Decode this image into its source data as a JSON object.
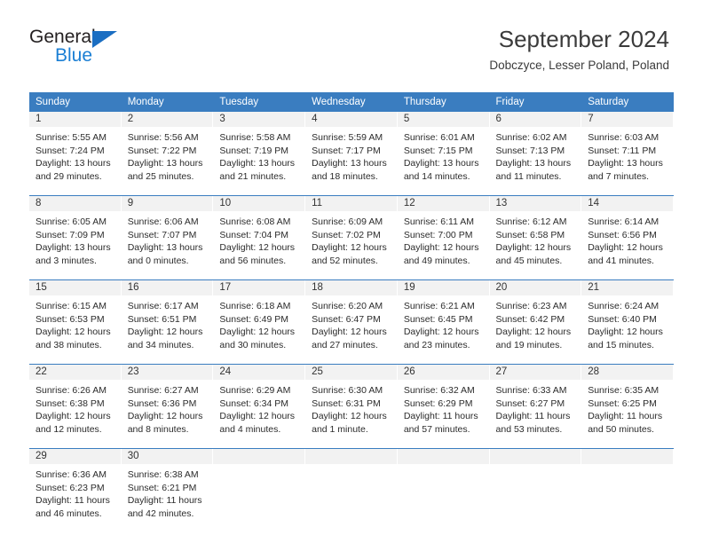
{
  "logo": {
    "word_top": "General",
    "word_bottom": "Blue",
    "triangle_color": "#1b6ec2",
    "blue_color": "#1b7fd4"
  },
  "header": {
    "title": "September 2024",
    "subtitle": "Dobczyce, Lesser Poland, Poland"
  },
  "theme": {
    "header_bg": "#3a7dc0",
    "header_text": "#ffffff",
    "daynum_band_bg": "#f2f2f2",
    "rule_color": "#3a7dc0"
  },
  "calendar": {
    "weekday_headers": [
      "Sunday",
      "Monday",
      "Tuesday",
      "Wednesday",
      "Thursday",
      "Friday",
      "Saturday"
    ],
    "weeks": [
      [
        {
          "day": "1",
          "sunrise": "Sunrise: 5:55 AM",
          "sunset": "Sunset: 7:24 PM",
          "daylight1": "Daylight: 13 hours",
          "daylight2": "and 29 minutes."
        },
        {
          "day": "2",
          "sunrise": "Sunrise: 5:56 AM",
          "sunset": "Sunset: 7:22 PM",
          "daylight1": "Daylight: 13 hours",
          "daylight2": "and 25 minutes."
        },
        {
          "day": "3",
          "sunrise": "Sunrise: 5:58 AM",
          "sunset": "Sunset: 7:19 PM",
          "daylight1": "Daylight: 13 hours",
          "daylight2": "and 21 minutes."
        },
        {
          "day": "4",
          "sunrise": "Sunrise: 5:59 AM",
          "sunset": "Sunset: 7:17 PM",
          "daylight1": "Daylight: 13 hours",
          "daylight2": "and 18 minutes."
        },
        {
          "day": "5",
          "sunrise": "Sunrise: 6:01 AM",
          "sunset": "Sunset: 7:15 PM",
          "daylight1": "Daylight: 13 hours",
          "daylight2": "and 14 minutes."
        },
        {
          "day": "6",
          "sunrise": "Sunrise: 6:02 AM",
          "sunset": "Sunset: 7:13 PM",
          "daylight1": "Daylight: 13 hours",
          "daylight2": "and 11 minutes."
        },
        {
          "day": "7",
          "sunrise": "Sunrise: 6:03 AM",
          "sunset": "Sunset: 7:11 PM",
          "daylight1": "Daylight: 13 hours",
          "daylight2": "and 7 minutes."
        }
      ],
      [
        {
          "day": "8",
          "sunrise": "Sunrise: 6:05 AM",
          "sunset": "Sunset: 7:09 PM",
          "daylight1": "Daylight: 13 hours",
          "daylight2": "and 3 minutes."
        },
        {
          "day": "9",
          "sunrise": "Sunrise: 6:06 AM",
          "sunset": "Sunset: 7:07 PM",
          "daylight1": "Daylight: 13 hours",
          "daylight2": "and 0 minutes."
        },
        {
          "day": "10",
          "sunrise": "Sunrise: 6:08 AM",
          "sunset": "Sunset: 7:04 PM",
          "daylight1": "Daylight: 12 hours",
          "daylight2": "and 56 minutes."
        },
        {
          "day": "11",
          "sunrise": "Sunrise: 6:09 AM",
          "sunset": "Sunset: 7:02 PM",
          "daylight1": "Daylight: 12 hours",
          "daylight2": "and 52 minutes."
        },
        {
          "day": "12",
          "sunrise": "Sunrise: 6:11 AM",
          "sunset": "Sunset: 7:00 PM",
          "daylight1": "Daylight: 12 hours",
          "daylight2": "and 49 minutes."
        },
        {
          "day": "13",
          "sunrise": "Sunrise: 6:12 AM",
          "sunset": "Sunset: 6:58 PM",
          "daylight1": "Daylight: 12 hours",
          "daylight2": "and 45 minutes."
        },
        {
          "day": "14",
          "sunrise": "Sunrise: 6:14 AM",
          "sunset": "Sunset: 6:56 PM",
          "daylight1": "Daylight: 12 hours",
          "daylight2": "and 41 minutes."
        }
      ],
      [
        {
          "day": "15",
          "sunrise": "Sunrise: 6:15 AM",
          "sunset": "Sunset: 6:53 PM",
          "daylight1": "Daylight: 12 hours",
          "daylight2": "and 38 minutes."
        },
        {
          "day": "16",
          "sunrise": "Sunrise: 6:17 AM",
          "sunset": "Sunset: 6:51 PM",
          "daylight1": "Daylight: 12 hours",
          "daylight2": "and 34 minutes."
        },
        {
          "day": "17",
          "sunrise": "Sunrise: 6:18 AM",
          "sunset": "Sunset: 6:49 PM",
          "daylight1": "Daylight: 12 hours",
          "daylight2": "and 30 minutes."
        },
        {
          "day": "18",
          "sunrise": "Sunrise: 6:20 AM",
          "sunset": "Sunset: 6:47 PM",
          "daylight1": "Daylight: 12 hours",
          "daylight2": "and 27 minutes."
        },
        {
          "day": "19",
          "sunrise": "Sunrise: 6:21 AM",
          "sunset": "Sunset: 6:45 PM",
          "daylight1": "Daylight: 12 hours",
          "daylight2": "and 23 minutes."
        },
        {
          "day": "20",
          "sunrise": "Sunrise: 6:23 AM",
          "sunset": "Sunset: 6:42 PM",
          "daylight1": "Daylight: 12 hours",
          "daylight2": "and 19 minutes."
        },
        {
          "day": "21",
          "sunrise": "Sunrise: 6:24 AM",
          "sunset": "Sunset: 6:40 PM",
          "daylight1": "Daylight: 12 hours",
          "daylight2": "and 15 minutes."
        }
      ],
      [
        {
          "day": "22",
          "sunrise": "Sunrise: 6:26 AM",
          "sunset": "Sunset: 6:38 PM",
          "daylight1": "Daylight: 12 hours",
          "daylight2": "and 12 minutes."
        },
        {
          "day": "23",
          "sunrise": "Sunrise: 6:27 AM",
          "sunset": "Sunset: 6:36 PM",
          "daylight1": "Daylight: 12 hours",
          "daylight2": "and 8 minutes."
        },
        {
          "day": "24",
          "sunrise": "Sunrise: 6:29 AM",
          "sunset": "Sunset: 6:34 PM",
          "daylight1": "Daylight: 12 hours",
          "daylight2": "and 4 minutes."
        },
        {
          "day": "25",
          "sunrise": "Sunrise: 6:30 AM",
          "sunset": "Sunset: 6:31 PM",
          "daylight1": "Daylight: 12 hours",
          "daylight2": "and 1 minute."
        },
        {
          "day": "26",
          "sunrise": "Sunrise: 6:32 AM",
          "sunset": "Sunset: 6:29 PM",
          "daylight1": "Daylight: 11 hours",
          "daylight2": "and 57 minutes."
        },
        {
          "day": "27",
          "sunrise": "Sunrise: 6:33 AM",
          "sunset": "Sunset: 6:27 PM",
          "daylight1": "Daylight: 11 hours",
          "daylight2": "and 53 minutes."
        },
        {
          "day": "28",
          "sunrise": "Sunrise: 6:35 AM",
          "sunset": "Sunset: 6:25 PM",
          "daylight1": "Daylight: 11 hours",
          "daylight2": "and 50 minutes."
        }
      ],
      [
        {
          "day": "29",
          "sunrise": "Sunrise: 6:36 AM",
          "sunset": "Sunset: 6:23 PM",
          "daylight1": "Daylight: 11 hours",
          "daylight2": "and 46 minutes."
        },
        {
          "day": "30",
          "sunrise": "Sunrise: 6:38 AM",
          "sunset": "Sunset: 6:21 PM",
          "daylight1": "Daylight: 11 hours",
          "daylight2": "and 42 minutes."
        },
        {
          "day": "",
          "sunrise": "",
          "sunset": "",
          "daylight1": "",
          "daylight2": ""
        },
        {
          "day": "",
          "sunrise": "",
          "sunset": "",
          "daylight1": "",
          "daylight2": ""
        },
        {
          "day": "",
          "sunrise": "",
          "sunset": "",
          "daylight1": "",
          "daylight2": ""
        },
        {
          "day": "",
          "sunrise": "",
          "sunset": "",
          "daylight1": "",
          "daylight2": ""
        },
        {
          "day": "",
          "sunrise": "",
          "sunset": "",
          "daylight1": "",
          "daylight2": ""
        }
      ]
    ]
  }
}
